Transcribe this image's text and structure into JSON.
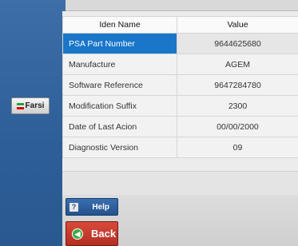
{
  "sidebar": {
    "language_button": {
      "label": "Farsi",
      "icon": "flag-icon",
      "flag_colors": [
        "#239f40",
        "#ffffff",
        "#da0000"
      ]
    }
  },
  "table": {
    "headers": {
      "name": "Iden Name",
      "value": "Value"
    },
    "selected_row": 0,
    "rows": [
      {
        "name": "PSA Part Number",
        "value": "9644625680"
      },
      {
        "name": "Manufacture",
        "value": "AGEM"
      },
      {
        "name": "Software Reference",
        "value": "9647284780"
      },
      {
        "name": "Modification Suffix",
        "value": "2300"
      },
      {
        "name": "Date of Last Acion",
        "value": "00/00/2000"
      },
      {
        "name": "Diagnostic Version",
        "value": "09"
      }
    ]
  },
  "footer": {
    "help_button": {
      "label": "Help",
      "icon": "help-icon",
      "icon_glyph": "?"
    },
    "back_button": {
      "label": "Back",
      "icon": "back-arrow-icon",
      "icon_glyph": "◀"
    }
  },
  "colors": {
    "accent": "#1976c9",
    "back": "#c0392b",
    "help": "#2f5f9a"
  }
}
